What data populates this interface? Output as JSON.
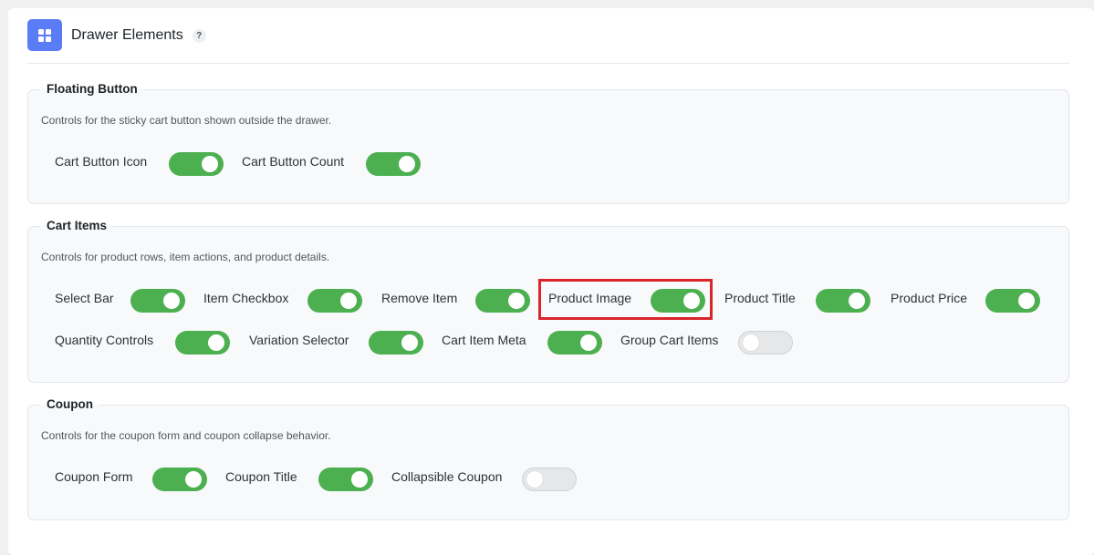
{
  "header": {
    "title": "Drawer Elements",
    "help": "?",
    "icon": "grid-icon",
    "icon_color": "#5b7cf7"
  },
  "colors": {
    "toggle_on": "#4caf50",
    "toggle_off": "#e6e7e9",
    "highlight": "#d9252b"
  },
  "sections": {
    "floating": {
      "legend": "Floating Button",
      "description": "Controls for the sticky cart button shown outside the drawer.",
      "options": [
        {
          "label": "Cart Button Icon",
          "enabled": true
        },
        {
          "label": "Cart Button Count",
          "enabled": true
        }
      ]
    },
    "cart_items": {
      "legend": "Cart Items",
      "description": "Controls for product rows, item actions, and product details.",
      "options": [
        {
          "label": "Select Bar",
          "enabled": true
        },
        {
          "label": "Item Checkbox",
          "enabled": true
        },
        {
          "label": "Remove Item",
          "enabled": true
        },
        {
          "label": "Product Image",
          "enabled": true,
          "highlighted": true
        },
        {
          "label": "Product Title",
          "enabled": true
        },
        {
          "label": "Product Price",
          "enabled": true
        },
        {
          "label": "Quantity Controls",
          "enabled": true
        },
        {
          "label": "Variation Selector",
          "enabled": true
        },
        {
          "label": "Cart Item Meta",
          "enabled": true
        },
        {
          "label": "Group Cart Items",
          "enabled": false
        }
      ]
    },
    "coupon": {
      "legend": "Coupon",
      "description": "Controls for the coupon form and coupon collapse behavior.",
      "options": [
        {
          "label": "Coupon Form",
          "enabled": true
        },
        {
          "label": "Coupon Title",
          "enabled": true
        },
        {
          "label": "Collapsible Coupon",
          "enabled": false
        }
      ]
    }
  }
}
